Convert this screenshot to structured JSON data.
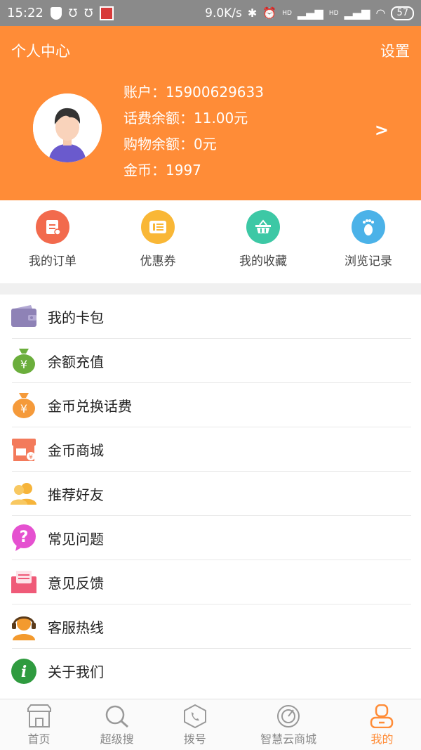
{
  "status_bar": {
    "time": "15:22",
    "speed": "9.0K/s",
    "battery": "57",
    "hd1": "HD",
    "hd2": "HD"
  },
  "header": {
    "title": "个人中心",
    "settings": "设置",
    "account": "账户：15900629633",
    "phone_balance": "话费余额：11.00元",
    "shopping_balance": "购物余额：0元",
    "coins": "金币：1997",
    "chevron": ">"
  },
  "quick_actions": [
    {
      "label": "我的订单",
      "icon": "order-icon",
      "color": "#f26a4d"
    },
    {
      "label": "优惠券",
      "icon": "coupon-icon",
      "color": "#f9b736"
    },
    {
      "label": "我的收藏",
      "icon": "basket-icon",
      "color": "#3dc8a5"
    },
    {
      "label": "浏览记录",
      "icon": "footprint-icon",
      "color": "#4bb2e8"
    }
  ],
  "menu": [
    {
      "label": "我的卡包",
      "icon": "wallet-icon",
      "color": "#8e82b6"
    },
    {
      "label": "余额充值",
      "icon": "money-bag-icon",
      "color": "#6bae3c"
    },
    {
      "label": "金币兑换话费",
      "icon": "coin-bag-icon",
      "color": "#f59a3a"
    },
    {
      "label": "金币商城",
      "icon": "shop-icon",
      "color": "#f37a5b"
    },
    {
      "label": "推荐好友",
      "icon": "friends-icon",
      "color": "#f6b43a"
    },
    {
      "label": "常见问题",
      "icon": "question-icon",
      "color": "#e551d0"
    },
    {
      "label": "意见反馈",
      "icon": "feedback-icon",
      "color": "#ef5a78"
    },
    {
      "label": "客服热线",
      "icon": "headset-icon",
      "color": "#f39a2e"
    },
    {
      "label": "关于我们",
      "icon": "info-icon",
      "color": "#2f9b3f"
    }
  ],
  "tabs": [
    {
      "label": "首页",
      "icon": "store-icon"
    },
    {
      "label": "超级搜",
      "icon": "search-icon"
    },
    {
      "label": "拨号",
      "icon": "phone-icon"
    },
    {
      "label": "智慧云商城",
      "icon": "radar-icon"
    },
    {
      "label": "我的",
      "icon": "user-icon",
      "active": true
    }
  ],
  "colors": {
    "accent": "#ff8c37",
    "statusbar": "#8a8a8a"
  }
}
